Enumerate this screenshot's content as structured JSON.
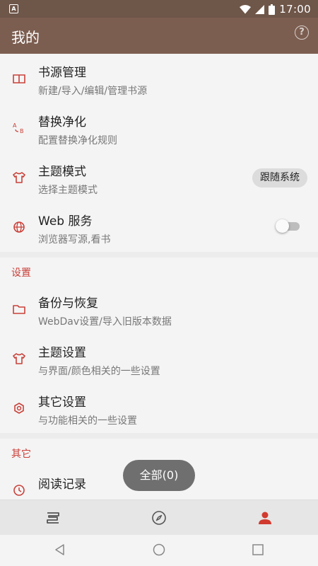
{
  "status_bar": {
    "app_badge": "A",
    "time": "17:00",
    "icons": [
      "wifi-icon",
      "signal-icon",
      "battery-icon"
    ]
  },
  "app_bar": {
    "title": "我的",
    "help_icon": "help-circle-icon"
  },
  "group1": [
    {
      "title": "书源管理",
      "subtitle": "新建/导入/编辑/管理书源",
      "icon": "book-open-icon"
    },
    {
      "title": "替换净化",
      "subtitle": "配置替换净化规则",
      "icon": "replace-ab-icon"
    },
    {
      "title": "主题模式",
      "subtitle": "选择主题模式",
      "icon": "shirt-icon",
      "chip": "跟随系统"
    },
    {
      "title": "Web 服务",
      "subtitle": "浏览器写源,看书",
      "icon": "globe-icon",
      "toggle": false
    }
  ],
  "settings": {
    "header": "设置",
    "items": [
      {
        "title": "备份与恢复",
        "subtitle": "WebDav设置/导入旧版本数据",
        "icon": "folder-icon"
      },
      {
        "title": "主题设置",
        "subtitle": "与界面/颜色相关的一些设置",
        "icon": "shirt-icon"
      },
      {
        "title": "其它设置",
        "subtitle": "与功能相关的一些设置",
        "icon": "gear-icon"
      }
    ]
  },
  "other": {
    "header": "其它",
    "items": [
      {
        "title": "阅读记录",
        "icon": "clock-icon"
      }
    ]
  },
  "toast": "全部(0)",
  "bottom_nav": {
    "items": [
      "bookshelf-icon",
      "compass-icon",
      "person-icon"
    ],
    "active": "person-icon"
  },
  "system_nav": [
    "back-icon",
    "home-icon",
    "recents-icon"
  ],
  "colors": {
    "app_bar": "#7c5e51",
    "status_bar": "#6e5649",
    "accent": "#c9413a",
    "background": "#f4f4f4"
  }
}
